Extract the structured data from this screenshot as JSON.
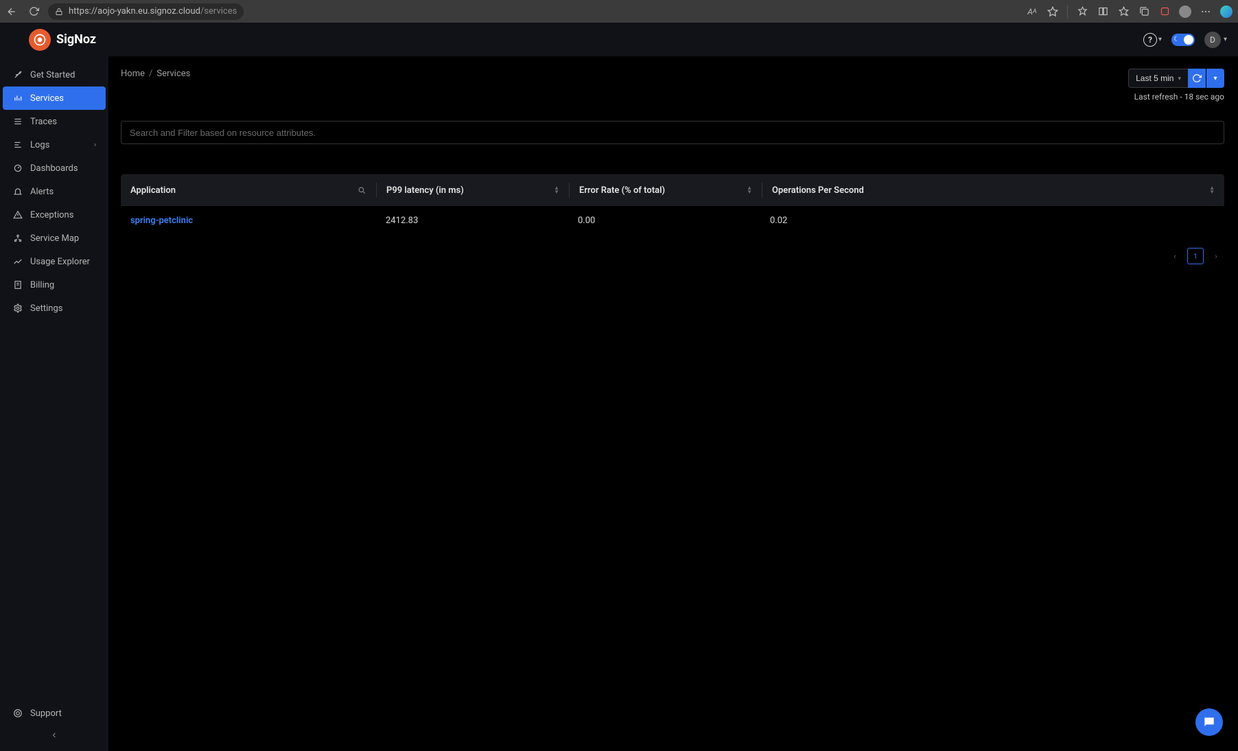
{
  "browser": {
    "url_host": "https://aojo-yakn.eu.signoz.cloud",
    "url_path": "/services"
  },
  "brand": {
    "name": "SigNoz"
  },
  "header": {
    "user_initial": "D"
  },
  "sidebar": {
    "items": [
      {
        "label": "Get Started"
      },
      {
        "label": "Services"
      },
      {
        "label": "Traces"
      },
      {
        "label": "Logs"
      },
      {
        "label": "Dashboards"
      },
      {
        "label": "Alerts"
      },
      {
        "label": "Exceptions"
      },
      {
        "label": "Service Map"
      },
      {
        "label": "Usage Explorer"
      },
      {
        "label": "Billing"
      },
      {
        "label": "Settings"
      }
    ],
    "support": "Support"
  },
  "breadcrumbs": {
    "home": "Home",
    "current": "Services"
  },
  "time": {
    "range_label": "Last 5 min",
    "last_refresh": "Last refresh - 18 sec ago"
  },
  "search": {
    "placeholder": "Search and Filter based on resource attributes."
  },
  "table": {
    "columns": {
      "app": "Application",
      "p99": "P99 latency (in ms)",
      "err": "Error Rate (% of total)",
      "ops": "Operations Per Second"
    },
    "rows": [
      {
        "app": "spring-petclinic",
        "p99": "2412.83",
        "err": "0.00",
        "ops": "0.02"
      }
    ]
  },
  "pagination": {
    "current": "1"
  }
}
